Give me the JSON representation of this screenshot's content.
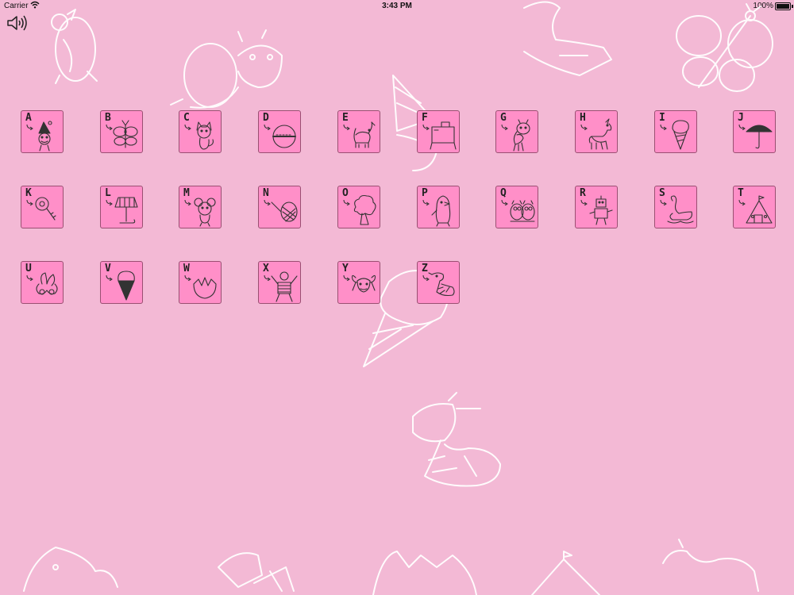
{
  "status_bar": {
    "carrier": "Carrier",
    "time": "3:43 PM",
    "battery": "100%"
  },
  "sound_button": {
    "icon": "speaker-icon"
  },
  "colors": {
    "background": "#f3b9d5",
    "tile": "#ff8fc8",
    "tile_border": "#9a4f72",
    "sketch": "#ffffff"
  },
  "tiles": [
    {
      "letter": "A",
      "icon": "clown-icon"
    },
    {
      "letter": "B",
      "icon": "butterfly-icon"
    },
    {
      "letter": "C",
      "icon": "cat-icon"
    },
    {
      "letter": "D",
      "icon": "disc-icon"
    },
    {
      "letter": "E",
      "icon": "elephant-icon"
    },
    {
      "letter": "F",
      "icon": "furniture-desk-icon"
    },
    {
      "letter": "G",
      "icon": "giraffe-icon"
    },
    {
      "letter": "H",
      "icon": "horse-icon"
    },
    {
      "letter": "I",
      "icon": "ice-cream-icon"
    },
    {
      "letter": "J",
      "icon": "umbrella-icon"
    },
    {
      "letter": "K",
      "icon": "key-icon"
    },
    {
      "letter": "L",
      "icon": "lamp-icon"
    },
    {
      "letter": "M",
      "icon": "mouse-icon"
    },
    {
      "letter": "N",
      "icon": "net-icon"
    },
    {
      "letter": "O",
      "icon": "tree-icon"
    },
    {
      "letter": "P",
      "icon": "penguin-icon"
    },
    {
      "letter": "Q",
      "icon": "owl-icon"
    },
    {
      "letter": "R",
      "icon": "robot-icon"
    },
    {
      "letter": "S",
      "icon": "swan-icon"
    },
    {
      "letter": "T",
      "icon": "tent-icon"
    },
    {
      "letter": "U",
      "icon": "flower-icon"
    },
    {
      "letter": "V",
      "icon": "cone-icon"
    },
    {
      "letter": "W",
      "icon": "eggshell-icon"
    },
    {
      "letter": "X",
      "icon": "xylophone-boy-icon"
    },
    {
      "letter": "Y",
      "icon": "yak-icon"
    },
    {
      "letter": "Z",
      "icon": "zebra-icon"
    }
  ]
}
